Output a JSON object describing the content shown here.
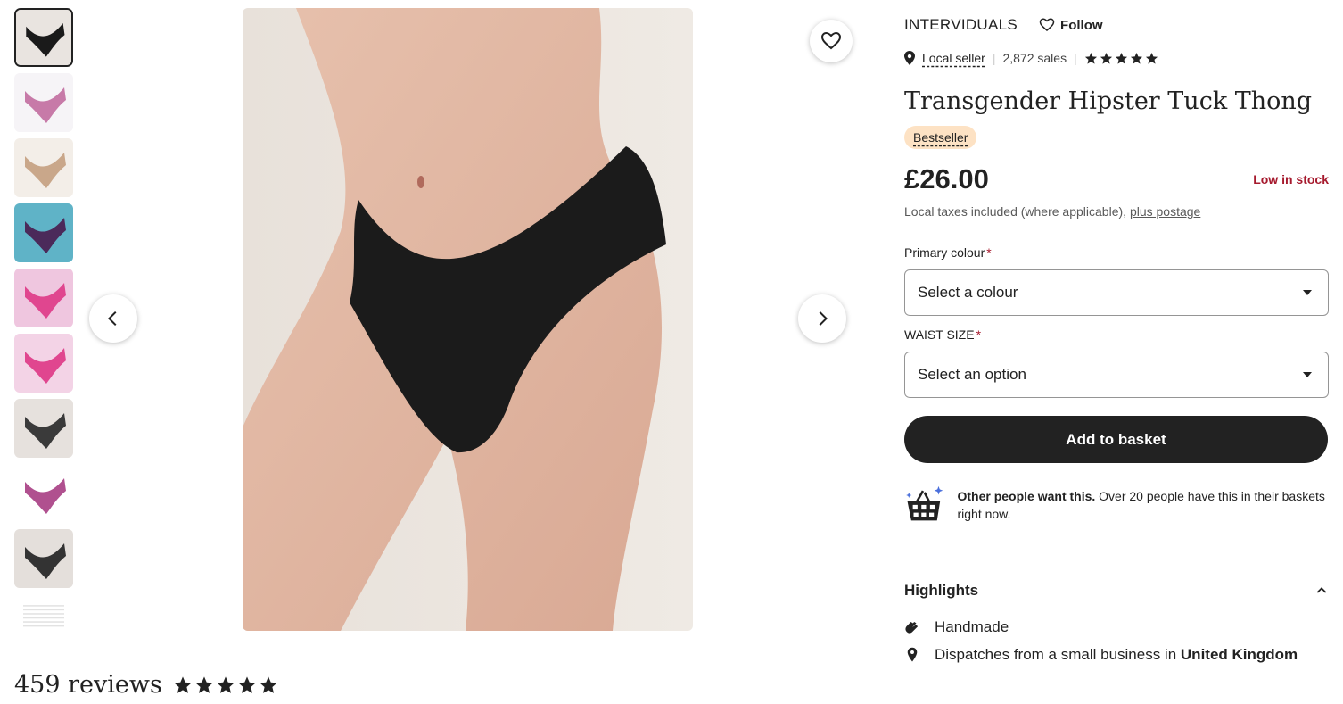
{
  "shop": {
    "name": "INTERVIDUALS",
    "follow_label": "Follow",
    "local_seller_label": "Local seller",
    "sales": "2,872 sales"
  },
  "product": {
    "title": "Transgender Hipster Tuck Thong",
    "badge": "Bestseller",
    "price": "£26.00",
    "stock": "Low in stock",
    "tax_text": "Local taxes included (where applicable),",
    "postage_link": "plus postage"
  },
  "options": {
    "colour_label": "Primary colour",
    "colour_placeholder": "Select a colour",
    "waist_label": "WAIST SIZE",
    "waist_placeholder": "Select an option",
    "required_mark": "*"
  },
  "actions": {
    "add_to_basket": "Add to basket"
  },
  "demand": {
    "bold": "Other people want this.",
    "text": "Over 20 people have this in their baskets right now."
  },
  "highlights": {
    "heading": "Highlights",
    "handmade": "Handmade",
    "dispatch_prefix": "Dispatches from a small business in",
    "dispatch_country": "United Kingdom"
  },
  "reviews": {
    "count_label": "459 reviews",
    "rating": 5
  },
  "colors": {
    "accent_red": "#a61a2e",
    "badge_bg": "#fde2c4",
    "button_bg": "#222222"
  },
  "thumbnails": [
    {
      "name": "black-thong-front",
      "bg": "#e9e4e0",
      "garment": "#1a1a1a"
    },
    {
      "name": "pink-purple-range",
      "bg": "#f6f4f7",
      "garment": "#c77aa8"
    },
    {
      "name": "nude-tones-range",
      "bg": "#f3eee8",
      "garment": "#c9a78a"
    },
    {
      "name": "pool-purple",
      "bg": "#5fb3c7",
      "garment": "#4b2a5a"
    },
    {
      "name": "pink-front",
      "bg": "#efc6df",
      "garment": "#e0468f"
    },
    {
      "name": "pink-back",
      "bg": "#f3d3e6",
      "garment": "#e0468f"
    },
    {
      "name": "black-front-2",
      "bg": "#e6e1dd",
      "garment": "#3a3a3a"
    },
    {
      "name": "purple-flat",
      "bg": "#ffffff",
      "garment": "#b0508f"
    },
    {
      "name": "black-front-3",
      "bg": "#e4dfdb",
      "garment": "#333333"
    },
    {
      "name": "size-chart",
      "bg": "#ffffff",
      "garment": "#cccccc"
    }
  ]
}
